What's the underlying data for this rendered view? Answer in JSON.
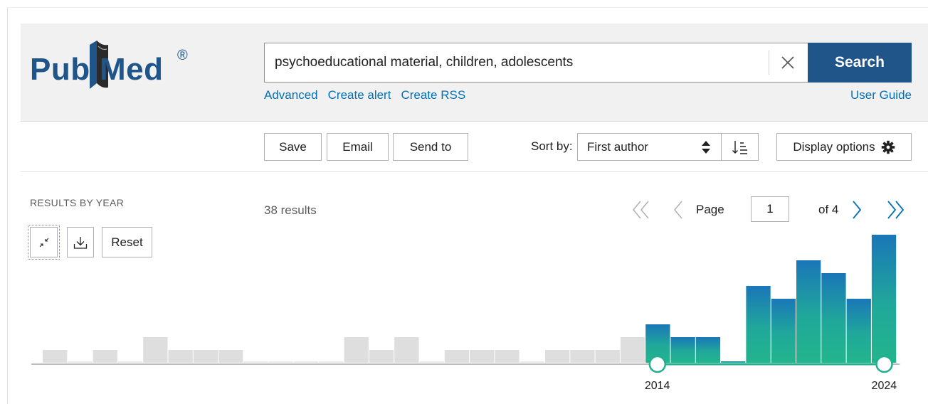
{
  "logo": {
    "text_pub": "Pub",
    "text_med": "Med",
    "registered": "®"
  },
  "search": {
    "query": "psychoeducational material, children, adolescents",
    "button_label": "Search"
  },
  "links": {
    "advanced": "Advanced",
    "create_alert": "Create alert",
    "create_rss": "Create RSS",
    "user_guide": "User Guide"
  },
  "toolbar": {
    "save": "Save",
    "email": "Email",
    "send_to": "Send to",
    "sort_label": "Sort by:",
    "sort_value": "First author",
    "display_options": "Display options"
  },
  "timeline": {
    "heading": "RESULTS BY YEAR",
    "reset": "Reset"
  },
  "results": {
    "count": "38 results"
  },
  "pagination": {
    "page_label": "Page",
    "current_page": "1",
    "of_label": "of 4"
  },
  "colors": {
    "brand": "#20558a",
    "link": "#0071bc",
    "bar_selected_top": "#1a76b8",
    "bar_selected": "#20b08f",
    "bar_unselected": "#dedede"
  },
  "chart_data": {
    "type": "bar",
    "x": [
      1990,
      1991,
      1992,
      1993,
      1994,
      1995,
      1996,
      1997,
      1998,
      1999,
      2000,
      2001,
      2002,
      2003,
      2004,
      2005,
      2006,
      2007,
      2008,
      2009,
      2010,
      2011,
      2012,
      2013,
      2014,
      2015,
      2016,
      2017,
      2018,
      2019,
      2020,
      2021,
      2022,
      2023,
      2024
    ],
    "values": [
      1,
      0,
      1,
      0,
      2,
      1,
      1,
      1,
      0,
      0,
      0,
      0,
      2,
      1,
      2,
      0,
      1,
      1,
      1,
      0,
      1,
      1,
      1,
      2,
      3,
      2,
      2,
      0,
      6,
      5,
      8,
      7,
      5,
      10
    ],
    "selected_range": [
      2014,
      2024
    ],
    "range_labels": [
      "2014",
      "2024"
    ]
  }
}
